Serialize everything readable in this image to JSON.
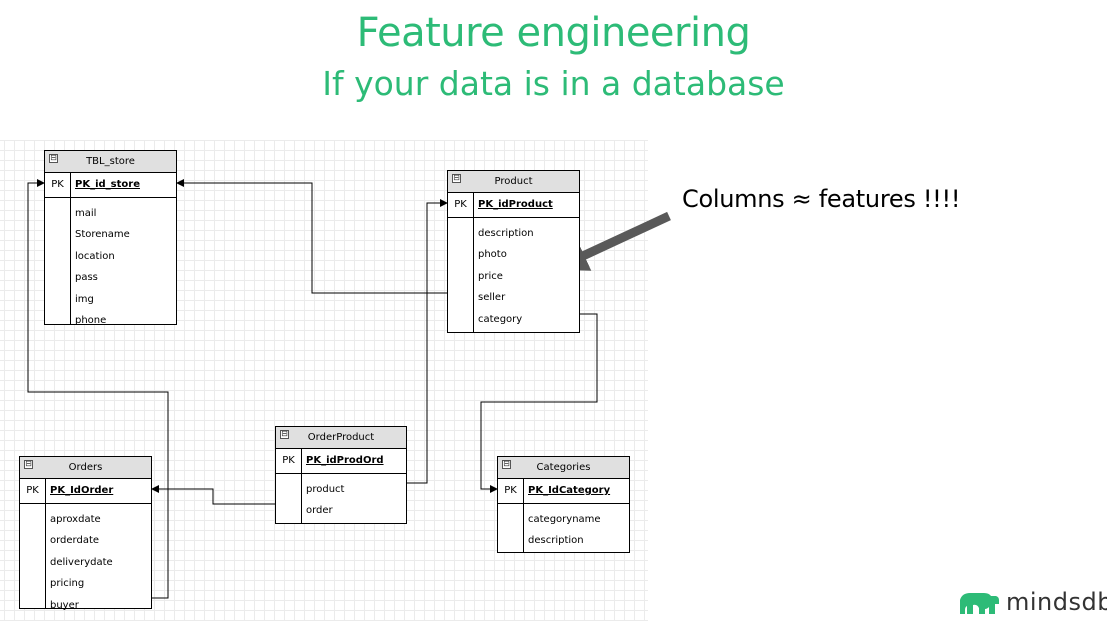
{
  "title": "Feature engineering",
  "subtitle": "If your data is in a database",
  "annotation": "Columns ≈ features  !!!!",
  "logo_text": "mindsdb",
  "colors": {
    "accent": "#2dbb77",
    "header_bg": "#e0e0e0",
    "arrow": "#595959"
  },
  "icons": {
    "collapse": "⊟",
    "logo": "bear-icon"
  },
  "entities": {
    "tbl_store": {
      "name": "TBL_store",
      "pk_label": "PK",
      "pk": "PK_id_store",
      "fields": [
        "mail",
        "Storename",
        "location",
        "pass",
        "img",
        "phone"
      ]
    },
    "product": {
      "name": "Product",
      "pk_label": "PK",
      "pk": "PK_idProduct",
      "fields": [
        "description",
        "photo",
        "price",
        "seller",
        "category"
      ]
    },
    "orders": {
      "name": "Orders",
      "pk_label": "PK",
      "pk": "PK_IdOrder",
      "fields": [
        "aproxdate",
        "orderdate",
        "deliverydate",
        "pricing",
        "buyer"
      ]
    },
    "orderproduct": {
      "name": "OrderProduct",
      "pk_label": "PK",
      "pk": "PK_idProdOrd",
      "fields": [
        "product",
        "order"
      ]
    },
    "categories": {
      "name": "Categories",
      "pk_label": "PK",
      "pk": "PK_IdCategory",
      "fields": [
        "categoryname",
        "description"
      ]
    }
  }
}
